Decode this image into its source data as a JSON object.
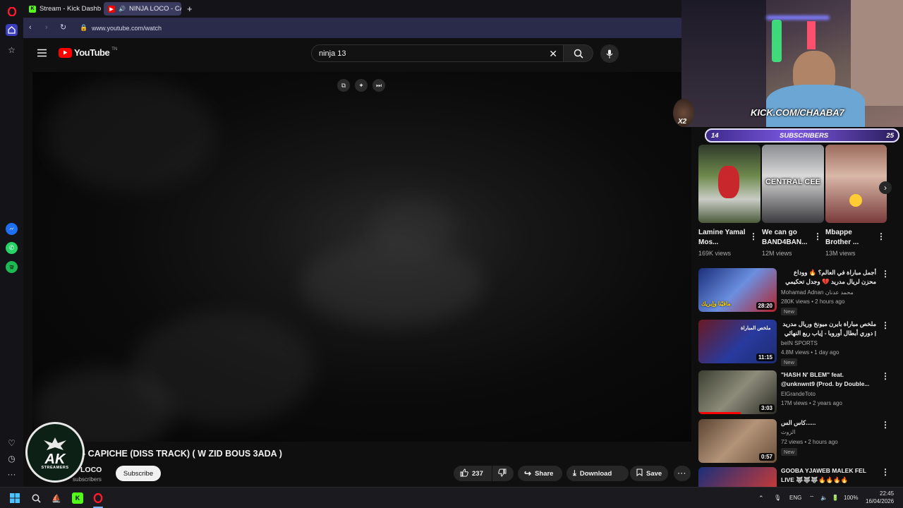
{
  "browser": {
    "tabs": [
      {
        "label": "Stream - Kick Dashboard",
        "favicon": "kick-icon",
        "active": false
      },
      {
        "label": "NINJA LOCO - CAPICHE",
        "favicon": "youtube-icon",
        "active": true
      }
    ],
    "new_tab_label": "+",
    "url": "www.youtube.com/watch"
  },
  "youtube": {
    "logo_text": "YouTube",
    "logo_suffix": "TN",
    "search_value": "ninja 13",
    "video": {
      "title": "- CAPICHE (DISS TRACK) ( W ZID BOUS 3ADA )",
      "channel_name": "LOCO",
      "subscribers": "subscribers",
      "subscribe_label": "Subscribe",
      "likes": "237",
      "share_label": "Share",
      "download_label": "Download",
      "save_label": "Save"
    },
    "shorts": [
      {
        "title": "Lamine Yamal Mos...",
        "views": "169K views"
      },
      {
        "title": "We can go BAND4BAN...",
        "views": "12M views",
        "overlay": "CENTRAL CEE"
      },
      {
        "title": "Mbappe Brother ...",
        "views": "13M views"
      }
    ],
    "recommendations": [
      {
        "title": "أجمل مباراة في العالم؟ 🔥 ووداع محزن لريال مدريد 💔 وجدل تحكيمي",
        "channel": "Mohamad Adnan محمد عدنان",
        "meta": "280K views • 2 hours ago",
        "duration": "28:20",
        "badge": "New",
        "thumb_text": "مافيّنا وإبريك"
      },
      {
        "title": "ملخص مباراة بايرن ميونخ وريال مدريد | دوري أبطال أوروبا - إياب ربع النهائي",
        "channel": "beIN SPORTS",
        "meta": "4.8M views • 1 day ago",
        "duration": "11:15",
        "badge": "New",
        "thumb_text": "ملخص المباراة"
      },
      {
        "title": "\"HASH N' BLEM\" feat. @unknwnt9 (Prod. by Double...",
        "channel": "ElGrandeToto",
        "meta": "17M views • 2 years ago",
        "duration": "3:03",
        "badge": ""
      },
      {
        "title": "كاس الس......",
        "channel": "الزوث",
        "meta": "72 views • 2 hours ago",
        "duration": "0:57",
        "badge": "New"
      },
      {
        "title": "GOOBA YJAWEB MALEK FEL LIVE 🐺🐺🐺🔥🔥🔥🔥",
        "channel": "",
        "meta": "",
        "duration": "",
        "badge": ""
      }
    ]
  },
  "overlay": {
    "kick_url": "KICK.COM/CHAABA7",
    "sub_goal_label": "SUBSCRIBERS",
    "sub_current": "14",
    "sub_target": "25",
    "logo_main": "AK",
    "logo_sub": "STREAMERS",
    "emote_count": "X2"
  },
  "taskbar": {
    "lang": "ENG",
    "battery": "100%",
    "time": "22:45",
    "date": "16/04/2026"
  },
  "colors": {
    "youtube_red": "#ff0000",
    "kick_green": "#53fc18",
    "opera_red": "#ff1b2d",
    "active_tab": "#3a3b5e"
  }
}
